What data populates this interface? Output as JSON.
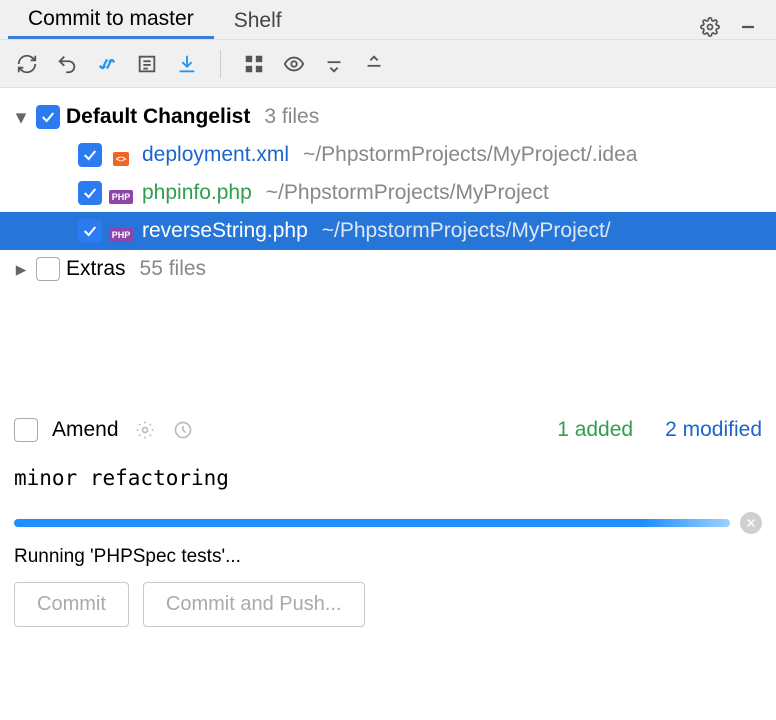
{
  "tabs": {
    "commit": "Commit to master",
    "shelf": "Shelf"
  },
  "tree": {
    "default": {
      "label": "Default Changelist",
      "count": "3 files"
    },
    "files": [
      {
        "name": "deployment.xml",
        "path": "~/PhpstormProjects/MyProject/.idea",
        "type": "xml",
        "color": "blue",
        "checked": true,
        "selected": false
      },
      {
        "name": "phpinfo.php",
        "path": "~/PhpstormProjects/MyProject",
        "type": "php",
        "color": "green",
        "checked": true,
        "selected": false
      },
      {
        "name": "reverseString.php",
        "path": "~/PhpstormProjects/MyProject/",
        "type": "php",
        "color": "blue",
        "checked": true,
        "selected": true
      }
    ],
    "extras": {
      "label": "Extras",
      "count": "55 files"
    }
  },
  "amend": {
    "label": "Amend"
  },
  "stats": {
    "added": "1 added",
    "modified": "2 modified"
  },
  "commit_message": "minor refactoring",
  "status": "Running 'PHPSpec tests'...",
  "buttons": {
    "commit": "Commit",
    "commit_push": "Commit and Push..."
  },
  "icons": {
    "xml_badge": "<>",
    "php_badge": "PHP"
  }
}
